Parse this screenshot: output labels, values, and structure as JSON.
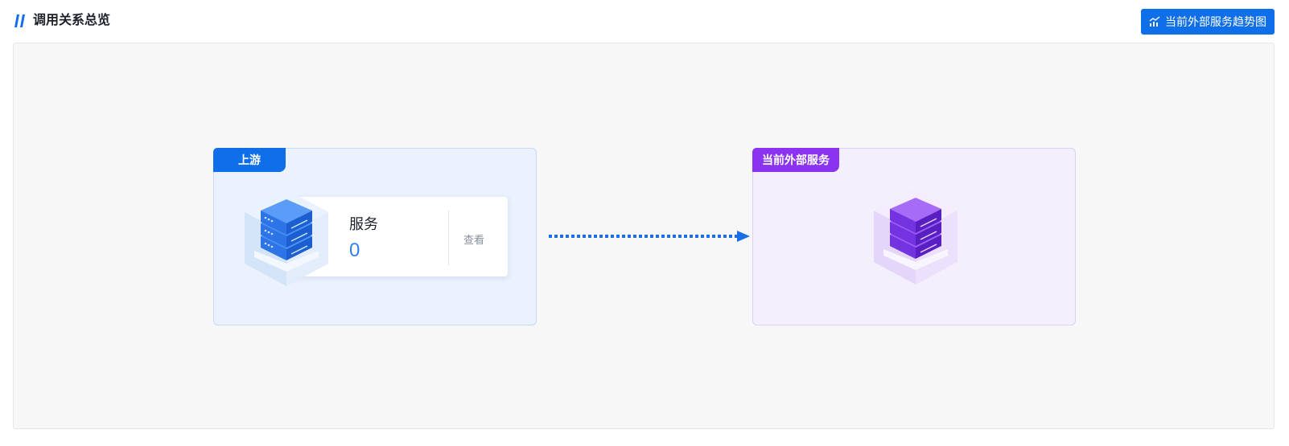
{
  "header": {
    "title": "调用关系总览",
    "trend_button_label": "当前外部服务趋势图"
  },
  "upstream": {
    "tag": "上游",
    "service_label": "服务",
    "service_count": "0",
    "view_label": "查看"
  },
  "current": {
    "tag": "当前外部服务"
  },
  "colors": {
    "primary": "#0f6fe8",
    "purple": "#8a34f1",
    "count_blue": "#2f80ed"
  },
  "icons": {
    "title_mark": "double-slash-icon",
    "trend": "chart-trend-icon",
    "upstream_server": "server-icon",
    "current_server": "server-icon",
    "arrow": "dotted-arrow-icon"
  }
}
